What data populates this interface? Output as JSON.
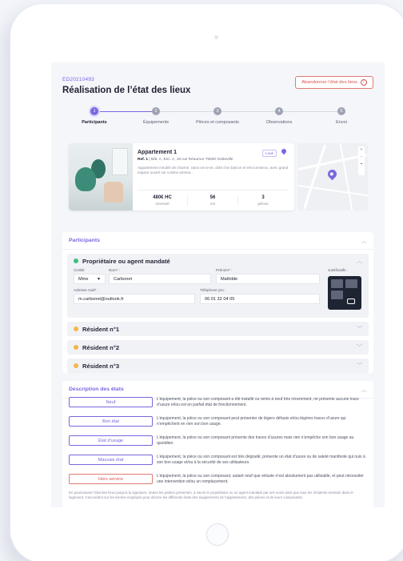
{
  "header": {
    "ref": "ED20210493",
    "title": "Réalisation de l’état des lieux",
    "abandon_label": "Abandonner l’état des lieux"
  },
  "stepper": [
    {
      "num": "1",
      "label": "Participants"
    },
    {
      "num": "2",
      "label": "Équipements"
    },
    {
      "num": "3",
      "label": "Pièces et composants"
    },
    {
      "num": "4",
      "label": "Observations"
    },
    {
      "num": "5",
      "label": "Envoi"
    }
  ],
  "property": {
    "name": "Appartement 1",
    "ref_label": "Ref. 1",
    "address": "Bât. A, Esc. A, 15 rue Réaumur 75000 Gotteville",
    "badge": "Loué",
    "description": "Appartement meublé de charme. Sans vis-à-vis, doté d’un balcon et très lumineux, avec grand espace ouvert sur cuisine aména...",
    "stats": [
      {
        "value": "480€ HC",
        "unit": "mensuel"
      },
      {
        "value": "56",
        "unit": "m2"
      },
      {
        "value": "3",
        "unit": "pièces"
      }
    ]
  },
  "participants": {
    "title": "Participants",
    "owner": {
      "title": "Propriétaire ou agent mandaté",
      "civility_label": "Civilité",
      "civility_value": "Mme",
      "name_label": "Nom* :",
      "name_value": "Carbonet",
      "firstname_label": "Prénom* :",
      "firstname_value": "Mathilde",
      "email_label": "Adresse mail* :",
      "email_value": "m.carbonet@outlook.fr",
      "phone_label": "Téléphone pro :",
      "phone_value": "06 01 32 04 05",
      "proof_label": "Justificatifs :"
    },
    "residents": [
      {
        "title": "Résident n°1"
      },
      {
        "title": "Résident n°2"
      },
      {
        "title": "Résident n°3"
      }
    ]
  },
  "states": {
    "title": "Description des états",
    "items": [
      {
        "label": "Neuf",
        "desc": "L’équipement, la pièce ou son composant a été installé ou remis à neuf très récemment, ne présente aucune trace d’usure et/ou est en parfait état de fonctionnement.",
        "color": "#7a66e0"
      },
      {
        "label": "Bon état",
        "desc": "L’équipement, la pièce ou son composant peut présenter de légers défauts et/ou légères traces d’usure qui n’empêchent en rien son bon usage.",
        "color": "#7a66e0"
      },
      {
        "label": "État d’usage",
        "desc": "L’équipement, la pièce ou son composant présente des traces d’usures mais rien n’empêche son bon usage au quotidien.",
        "color": "#7a66e0"
      },
      {
        "label": "Mauvais état",
        "desc": "L’équipement, la pièce ou son composant est très dégradé, présente un état d’usure ou de saleté manifeste qui nuis à son bon usage et/ou à la sécurité de ses utilisateurs.",
        "color": "#7a66e0"
      },
      {
        "label": "Hors service",
        "desc": "L’équipement, la pièce ou son composant, autant neuf que vétuste n’est absolument pas utilisable, et peut nécessiter une intervention et/ou un remplacement.",
        "color": "#d9534f"
      }
    ],
    "footnote": "En poursuivant l’état des lieux jusqu’à la signature, toutes les parties présentes, à savoir le propriétaire ou un agent mandaté par ses soins ainsi que tous les résidents entrants dans le logement, s’accordent sur les termes employés pour décrire les différents états des équipements de l’appartement, des pièces et de leurs composants."
  }
}
